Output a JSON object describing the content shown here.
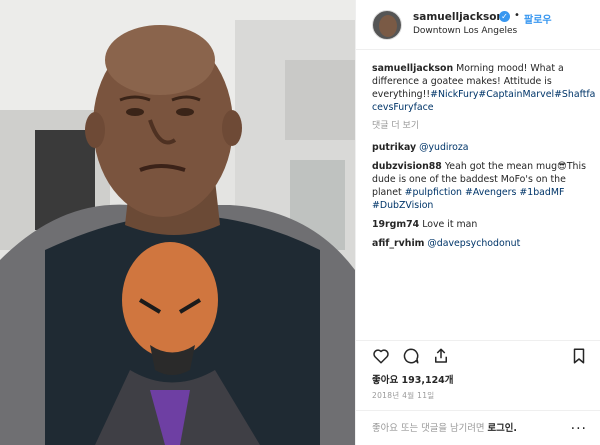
{
  "header": {
    "username": "samuelljackson",
    "verified_icon": "check-badge-icon",
    "separator": "•",
    "follow_label": "팔로우",
    "location": "Downtown Los Angeles"
  },
  "caption": {
    "author": "samuelljackson",
    "text": "Morning mood! What a difference a goatee makes! Attitude is everything!!",
    "hashtags": "#NickFury#CaptainMarvel#Shaftfa cevsFuryface"
  },
  "view_more": "댓글 더 보기",
  "comments": [
    {
      "author": "putrikay",
      "text": "",
      "link": "@yudiroza"
    },
    {
      "author": "dubzvision88",
      "text": "Yeah got the mean mug😎This dude is one of the baddest MoFo's on the planet",
      "link": "#pulpfiction #Avengers #1badMF #DubZVision"
    },
    {
      "author": "19rgm74",
      "text": "Love it man",
      "link": ""
    },
    {
      "author": "afif_rvhim",
      "text": "",
      "link": "@davepsychodonut"
    }
  ],
  "actions": {
    "like_icon": "heart-icon",
    "comment_icon": "comment-icon",
    "share_icon": "share-icon",
    "save_icon": "bookmark-icon"
  },
  "likes": "좋아요 193,124개",
  "date": "2018년 4월 11일",
  "footer": {
    "prompt": "좋아요 또는 댓글을 남기려면",
    "login": "로그인.",
    "more": "..."
  },
  "colors": {
    "link": "#003569",
    "follow": "#3897f0",
    "muted": "#999999"
  }
}
